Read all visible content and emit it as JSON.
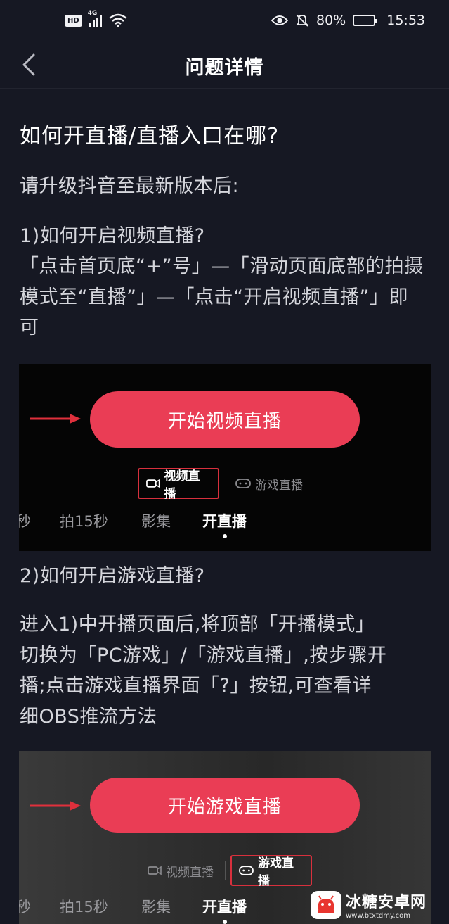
{
  "status_bar": {
    "hd": "HD",
    "network": "4G",
    "battery_percent": "80%",
    "battery_level": 0.8,
    "time": "15:53"
  },
  "nav": {
    "title": "问题详情"
  },
  "article": {
    "title": "如何开直播/直播入口在哪?",
    "intro": "请升级抖音至最新版本后:",
    "section1_heading": "1)如何开启视频直播?",
    "section1_line1": "「点击首页底“+”号」—「滑动页面底部的拍摄",
    "section1_line2": "模式至“直播”」—「点击“开启视频直播”」即",
    "section1_line3": "可",
    "section2_heading": "2)如何开启游戏直播?",
    "section2_line1": "进入1)中开播页面后,将顶部「开播模式」",
    "section2_line2": "切换为「PC游戏」/「游戏直播」,按步骤开",
    "section2_line3": "播;点击游戏直播界面「?」按钮,可查看详",
    "section2_line4": "细OBS推流方法"
  },
  "screenshot1": {
    "button_label": "开始视频直播",
    "mode_video": "视频直播",
    "mode_game": "游戏直播",
    "tab_partial": "秒",
    "tab_15s": "拍15秒",
    "tab_album": "影集",
    "tab_live": "开直播"
  },
  "screenshot2": {
    "button_label": "开始游戏直播",
    "mode_video": "视频直播",
    "mode_game": "游戏直播",
    "tab_partial": "秒",
    "tab_15s": "拍15秒",
    "tab_album": "影集",
    "tab_live": "开直播"
  },
  "watermark": {
    "name": "冰糖安卓网",
    "url": "www.btxtdmy.com"
  },
  "colors": {
    "background": "#161823",
    "accent": "#ea3d55",
    "highlight_box": "#d8303d"
  }
}
